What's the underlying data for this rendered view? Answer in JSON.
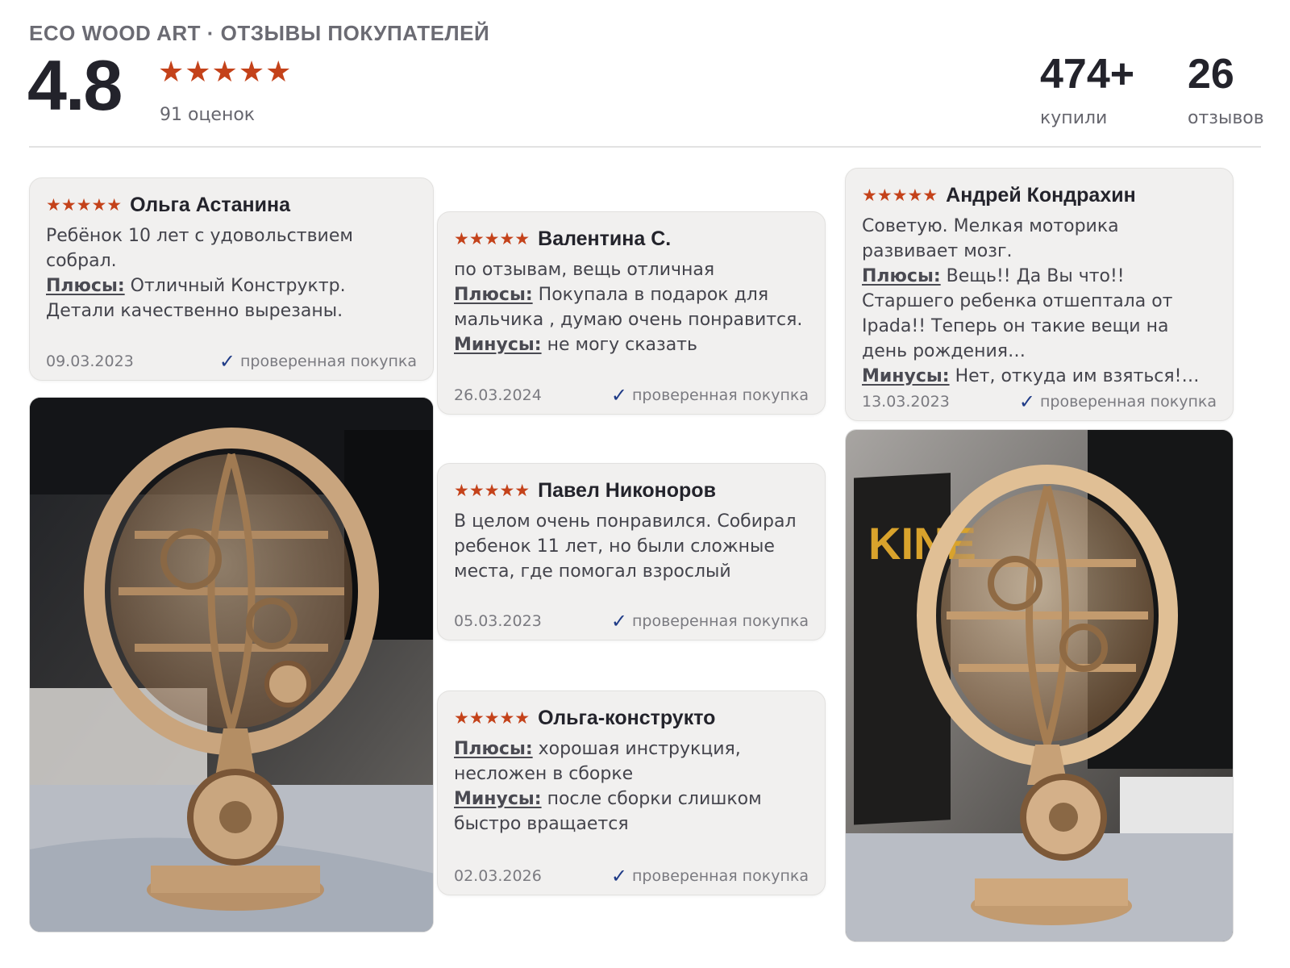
{
  "header": {
    "brand": "ECO WOOD ART · ОТЗЫВЫ ПОКУПАТЕЛЕЙ",
    "score": "4.8",
    "stars": "★★★★★",
    "ratings_count": "91 оценок",
    "bought_num": "474+",
    "bought_label": "купили",
    "reviews_num": "26",
    "reviews_label": "отзывов"
  },
  "colors": {
    "star": "#c4421a",
    "check": "#1f3b87",
    "card_bg": "#f1f0ef"
  },
  "reviews": [
    {
      "stars": "★★★★★",
      "author": "Ольга Астанина",
      "lines": [
        "Ребёнок 10 лет с удовольствием собрал."
      ],
      "plus_label": "Плюсы:",
      "plus_text": " Отличный Конструктр. Детали качественно вырезаны.",
      "date": "09.03.2023",
      "verified": "проверенная покупка"
    },
    {
      "stars": "★★★★★",
      "author": "Валентина С.",
      "lines": [
        "по отзывам, вещь отличная"
      ],
      "plus_label": "Плюсы:",
      "plus_text": " Покупала в подарок для мальчика , думаю очень понравится.",
      "minus_label": "Минусы:",
      "minus_text": " не могу сказать",
      "date": "26.03.2024",
      "verified": "проверенная покупка"
    },
    {
      "stars": "★★★★★",
      "author": "Андрей Кондрахин",
      "lines": [
        "Советую. Мелкая моторика развивает мозг."
      ],
      "plus_label": "Плюсы:",
      "plus_text": " Вещь!! Да Вы что!! Старшего ребенка отшептала от Ipada!! Теперь он такие вещи на день рождения…",
      "minus_label": "Минусы:",
      "minus_text": " Нет, откуда им взяться!…",
      "date": "13.03.2023",
      "verified": "проверенная покупка"
    },
    {
      "stars": "★★★★★",
      "author": "Павел Никоноров",
      "lines": [
        "В целом очень понравился. Собирал ребенок 11 лет, но были сложные места, где помогал взрослый"
      ],
      "date": "05.03.2023",
      "verified": "проверенная покупка"
    },
    {
      "stars": "★★★★★",
      "author": "Ольга-конструкто",
      "plus_label": "Плюсы:",
      "plus_text": " хорошая инструкция, несложен в сборке",
      "minus_label": "Минусы:",
      "minus_text": " после сборки слишком быстро вращается",
      "date": "02.03.2026",
      "verified": "проверенная покупка"
    }
  ],
  "photos": {
    "left_box_text": "",
    "right_box_text": "KINE"
  }
}
